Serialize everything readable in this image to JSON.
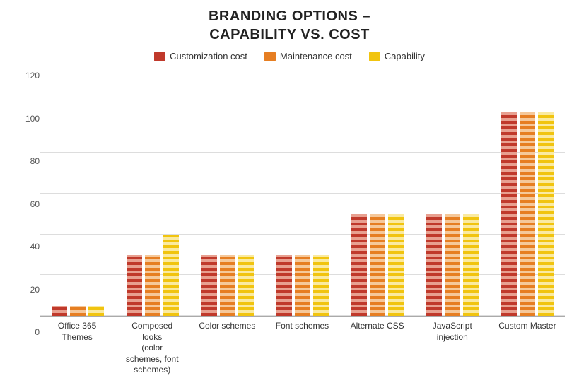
{
  "title": {
    "line1": "BRANDING OPTIONS –",
    "line2": "CAPABILITY VS. COST"
  },
  "legend": [
    {
      "id": "customization",
      "label": "Customization cost",
      "color": "red"
    },
    {
      "id": "maintenance",
      "label": "Maintenance cost",
      "color": "orange"
    },
    {
      "id": "capability",
      "label": "Capability",
      "color": "yellow"
    }
  ],
  "yAxis": {
    "labels": [
      "0",
      "20",
      "40",
      "60",
      "80",
      "100",
      "120"
    ]
  },
  "groups": [
    {
      "label": "Office 365\nThemes",
      "bars": [
        5,
        5,
        5
      ]
    },
    {
      "label": "Composed\nlooks\n(color\nschemes, font\nschemes)",
      "bars": [
        30,
        30,
        40
      ]
    },
    {
      "label": "Color schemes",
      "bars": [
        30,
        30,
        30
      ]
    },
    {
      "label": "Font schemes",
      "bars": [
        30,
        30,
        30
      ]
    },
    {
      "label": "Alternate CSS",
      "bars": [
        50,
        50,
        50
      ]
    },
    {
      "label": "JavaScript\ninjection",
      "bars": [
        50,
        50,
        50
      ]
    },
    {
      "label": "Custom Master",
      "bars": [
        100,
        100,
        100
      ]
    }
  ],
  "chart": {
    "maxValue": 120,
    "barColors": [
      "bar-red",
      "bar-orange",
      "bar-yellow"
    ]
  }
}
